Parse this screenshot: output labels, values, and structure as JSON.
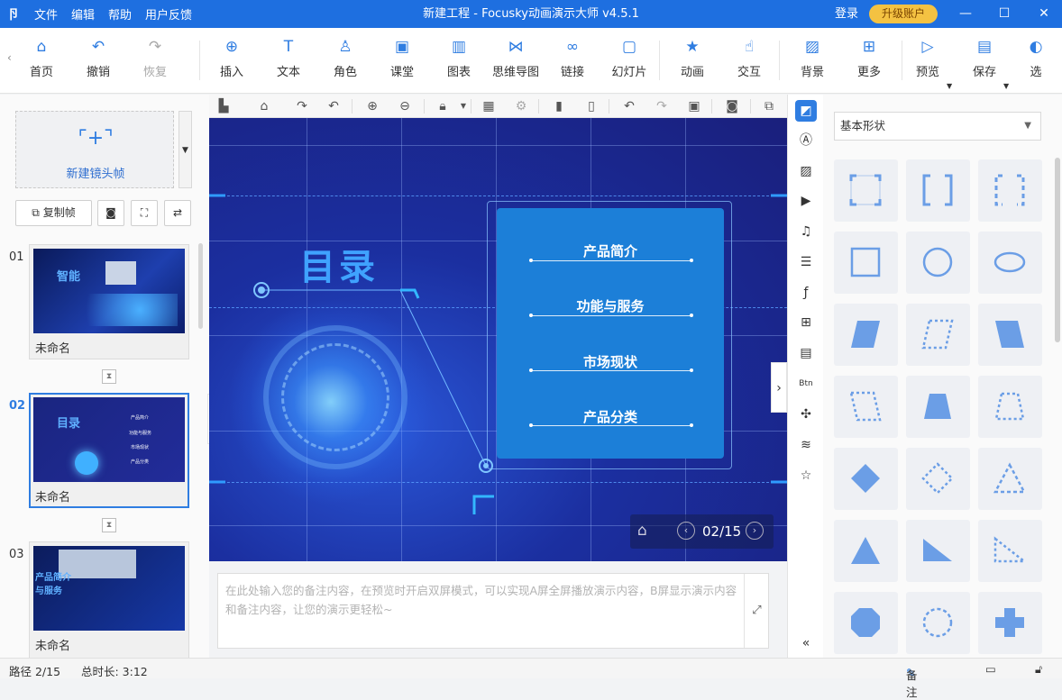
{
  "window": {
    "logo": "卪",
    "menu": [
      "文件",
      "编辑",
      "帮助",
      "用户反馈"
    ],
    "title": "新建工程 - Focusky动画演示大师  v4.5.1",
    "login": "登录",
    "upgrade": "升级账户"
  },
  "toolbar": {
    "items": [
      {
        "label": "首页",
        "icon": "home-icon"
      },
      {
        "label": "撤销",
        "icon": "undo-icon"
      },
      {
        "label": "恢复",
        "icon": "redo-icon"
      },
      {
        "label": "插入",
        "icon": "insert-icon"
      },
      {
        "label": "文本",
        "icon": "text-icon"
      },
      {
        "label": "角色",
        "icon": "character-icon"
      },
      {
        "label": "课堂",
        "icon": "classroom-icon"
      },
      {
        "label": "图表",
        "icon": "chart-icon"
      },
      {
        "label": "思维导图",
        "icon": "mindmap-icon"
      },
      {
        "label": "链接",
        "icon": "link-icon"
      },
      {
        "label": "幻灯片",
        "icon": "slide-icon"
      },
      {
        "label": "动画",
        "icon": "animation-icon"
      },
      {
        "label": "交互",
        "icon": "interaction-icon"
      },
      {
        "label": "背景",
        "icon": "background-icon"
      },
      {
        "label": "更多",
        "icon": "more-icon"
      },
      {
        "label": "预览",
        "icon": "preview-icon"
      },
      {
        "label": "保存",
        "icon": "save-icon"
      },
      {
        "label": "选",
        "icon": "select-icon"
      }
    ]
  },
  "leftpanel": {
    "new_frame": "新建镜头帧",
    "copy_frame": "复制帧",
    "slides": [
      {
        "num": "01",
        "name": "未命名",
        "thumb_title": "智能"
      },
      {
        "num": "02",
        "name": "未命名",
        "thumb_title": "目录"
      },
      {
        "num": "03",
        "name": "未命名",
        "thumb_title": "产品简介与服务"
      }
    ],
    "thumb2_items": [
      "产品简介",
      "功能与服务",
      "市场现状",
      "产品分类"
    ]
  },
  "stage": {
    "heading": "目录",
    "items": [
      "产品简介",
      "功能与服务",
      "市场现状",
      "产品分类"
    ],
    "pager": "02/15"
  },
  "notes": {
    "placeholder": "在此处输入您的备注内容，在预览时开启双屏模式，可以实现A屏全屏播放演示内容，B屏显示演示内容和备注内容，让您的演示更轻松~"
  },
  "rightpanel": {
    "shape_category": "基本形状"
  },
  "status": {
    "path": "路径 2/15",
    "duration": "总时长: 3:12",
    "notes_label": "备注"
  },
  "colors": {
    "brand": "#1e6fe0",
    "accent": "#2f7de1",
    "upgrade": "#f4c242",
    "shape_fill": "#6b9ee6"
  }
}
